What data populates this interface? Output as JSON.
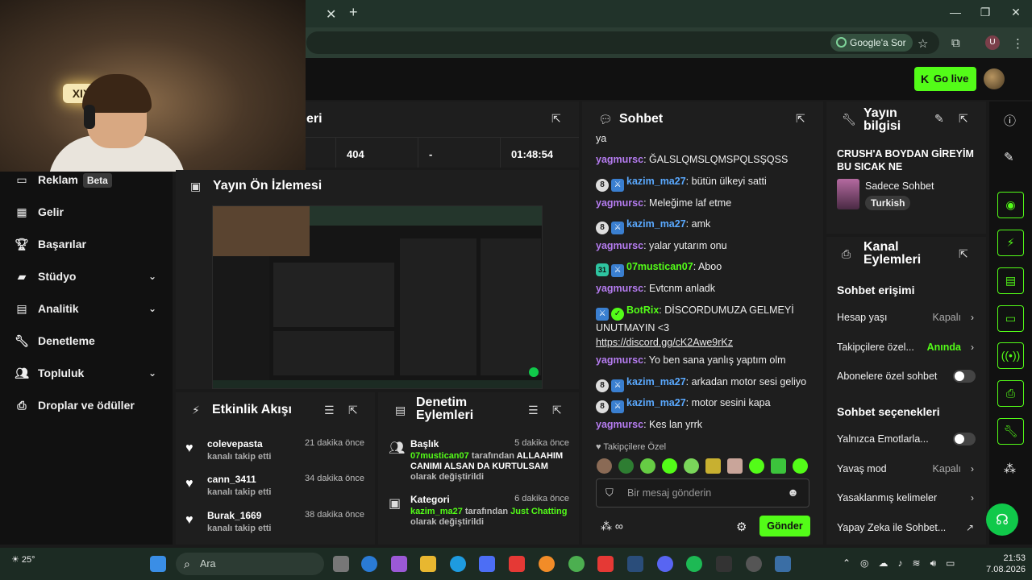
{
  "browser": {
    "ask_google": "Google'a Sor",
    "profile_initial": "U"
  },
  "header": {
    "go_live": "Go live"
  },
  "webcam": {
    "neon_text": "XIX"
  },
  "sidebar": {
    "items": [
      {
        "label": "Reklam",
        "badge": "Beta",
        "icon": "ad-icon"
      },
      {
        "label": "Gelir",
        "icon": "revenue-icon"
      },
      {
        "label": "Başarılar",
        "icon": "trophy-icon"
      },
      {
        "label": "Stüdyo",
        "icon": "studio-icon",
        "expandable": true
      },
      {
        "label": "Analitik",
        "icon": "analytics-icon",
        "expandable": true
      },
      {
        "label": "Denetleme",
        "icon": "wrench-icon"
      },
      {
        "label": "Topluluk",
        "icon": "community-icon",
        "expandable": true
      },
      {
        "label": "Droplar ve ödüller",
        "icon": "drops-icon"
      }
    ]
  },
  "stats": {
    "title_partial": "eri",
    "viewers": "404",
    "dash": "-",
    "uptime": "01:48:54"
  },
  "preview": {
    "title": "Yayın Ön İzlemesi"
  },
  "activity": {
    "title": "Etkinlik Akışı",
    "items": [
      {
        "name": "colevepasta",
        "sub": "kanalı takip etti",
        "time": "21 dakika önce"
      },
      {
        "name": "cann_3411",
        "sub": "kanalı takip etti",
        "time": "34 dakika önce"
      },
      {
        "name": "Burak_1669",
        "sub": "kanalı takip etti",
        "time": "38 dakika önce"
      }
    ]
  },
  "modactions": {
    "title": "Denetim Eylemleri",
    "items": [
      {
        "title": "Başlık",
        "time": "5 dakika önce",
        "user": "07mustican07",
        "mid": "tarafından",
        "value": "ALLAAHIM CANIMI ALSAN DA KURTULSAM",
        "tail": "olarak değiştirildi"
      },
      {
        "title": "Kategori",
        "time": "6 dakika önce",
        "user": "kazim_ma27",
        "mid": "tarafından",
        "value": "Just Chatting",
        "tail": "olarak değiştirildi"
      }
    ]
  },
  "chat": {
    "title": "Sohbet",
    "messages": [
      {
        "user": "",
        "text": "ya",
        "color": "none"
      },
      {
        "user": "yagmursc",
        "text": "ĞALSLQMSLQMSPQLSŞQSS",
        "color": "purple"
      },
      {
        "user": "kazim_ma27",
        "text": "bütün ülkeyi satti",
        "color": "blue",
        "badge": "8"
      },
      {
        "user": "yagmursc",
        "text": "Meleğime laf etme",
        "color": "purple"
      },
      {
        "user": "kazim_ma27",
        "text": "amk",
        "color": "blue",
        "badge": "8"
      },
      {
        "user": "yagmursc",
        "text": "yalar yutarım onu",
        "color": "purple"
      },
      {
        "user": "07mustican07",
        "text": "Aboo",
        "color": "green",
        "badge": "31"
      },
      {
        "user": "yagmursc",
        "text": "Evtcnm anladk",
        "color": "purple"
      },
      {
        "user": "BotRix",
        "text": "DİSCORDUMUZA GELMEYİ UNUTMAYIN <3",
        "link": "https://discord.gg/cK2Awe9rKz",
        "color": "green"
      },
      {
        "user": "yagmursc",
        "text": "Yo ben sana yanlış yaptım olm",
        "color": "purple"
      },
      {
        "user": "kazim_ma27",
        "text": "arkadan motor sesi geliyo",
        "color": "blue",
        "badge": "8"
      },
      {
        "user": "kazim_ma27",
        "text": "motor sesini kapa",
        "color": "blue",
        "badge": "8"
      },
      {
        "user": "yagmursc",
        "text": "Kes lan yrrk",
        "color": "purple"
      }
    ],
    "followers_only": "Takipçilere Özel",
    "input_placeholder": "Bir mesaj gönderin",
    "send": "Gönder"
  },
  "streaminfo": {
    "title": "Yayın bilgisi",
    "stream_title": "CRUSH'A BOYDAN GİREYİM BU SICAK NE",
    "category": "Sadece Sohbet",
    "language": "Turkish"
  },
  "channelactions": {
    "title": "Kanal Eylemleri",
    "chat_access": "Sohbet erişimi",
    "account_age": "Hesap yaşı",
    "account_age_val": "Kapalı",
    "followers_only": "Takipçilere özel...",
    "followers_only_val": "Anında",
    "subs_only": "Abonelere özel sohbet",
    "chat_options": "Sohbet seçenekleri",
    "emotes_only": "Yalnızca Emotlarla...",
    "slow_mode": "Yavaş mod",
    "slow_mode_val": "Kapalı",
    "banned_words": "Yasaklanmış kelimeler",
    "ai_chat": "Yapay Zeka ile Sohbet..."
  },
  "taskbar": {
    "temperature": "25°",
    "search": "Ara",
    "time": "21:53",
    "date": "7.08.2026"
  },
  "colors": {
    "accent": "#53fc18",
    "panel": "#1e1e1e",
    "bg": "#111111"
  }
}
